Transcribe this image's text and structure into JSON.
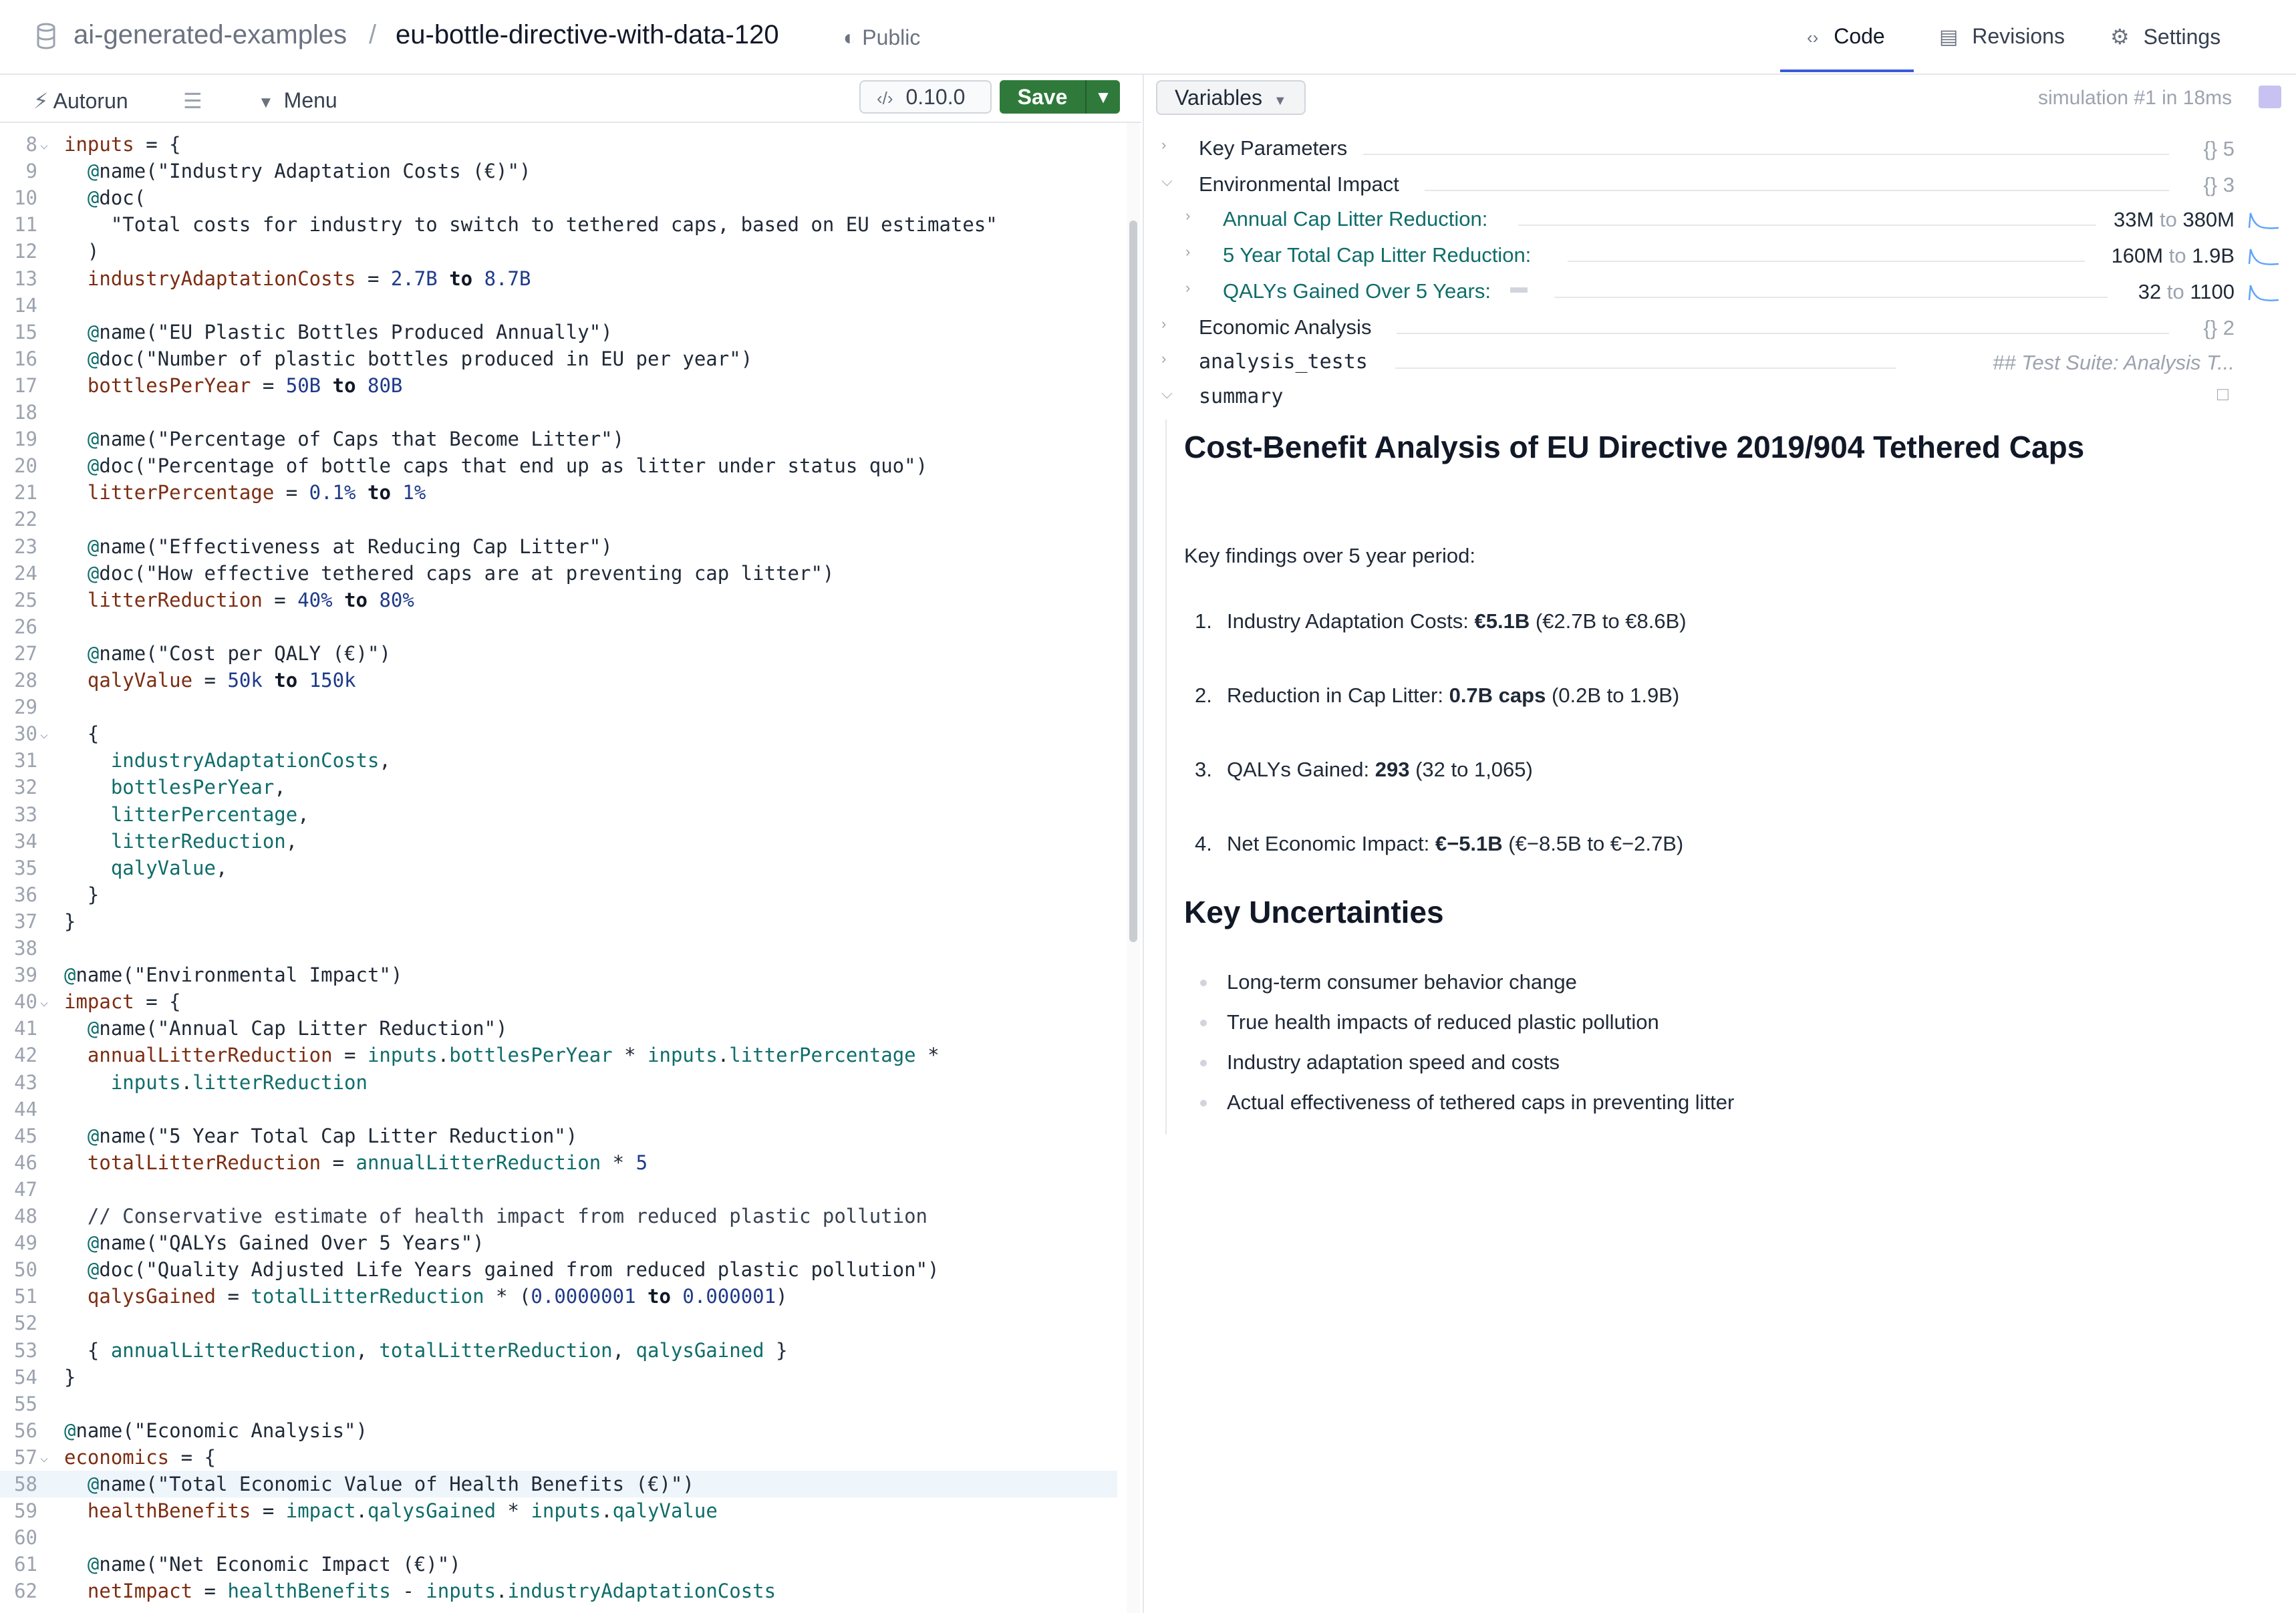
{
  "header": {
    "owner": "ai-generated-examples",
    "separator": "/",
    "model": "eu-bottle-directive-with-data-120",
    "visibility": "Public",
    "tabs": [
      {
        "label": "Code",
        "icon": "code-icon",
        "active": true
      },
      {
        "label": "Revisions",
        "icon": "revisions-icon",
        "active": false
      },
      {
        "label": "Settings",
        "icon": "gear-icon",
        "active": false
      }
    ]
  },
  "toolbar": {
    "autorun": "Autorun",
    "menu": "Menu",
    "version": "0.10.0",
    "save": "Save"
  },
  "editor": {
    "highlighted_line": 58,
    "lines": [
      {
        "n": "8",
        "fold": true,
        "code": "inputs = {"
      },
      {
        "n": "9",
        "code": "  @name(\"Industry Adaptation Costs (€)\")"
      },
      {
        "n": "10",
        "code": "  @doc("
      },
      {
        "n": "11",
        "code": "    \"Total costs for industry to switch to tethered caps, based on EU estimates\""
      },
      {
        "n": "12",
        "code": "  )"
      },
      {
        "n": "13",
        "code": "  industryAdaptationCosts = 2.7B to 8.7B"
      },
      {
        "n": "14",
        "code": ""
      },
      {
        "n": "15",
        "code": "  @name(\"EU Plastic Bottles Produced Annually\")"
      },
      {
        "n": "16",
        "code": "  @doc(\"Number of plastic bottles produced in EU per year\")"
      },
      {
        "n": "17",
        "code": "  bottlesPerYear = 50B to 80B"
      },
      {
        "n": "18",
        "code": ""
      },
      {
        "n": "19",
        "code": "  @name(\"Percentage of Caps that Become Litter\")"
      },
      {
        "n": "20",
        "code": "  @doc(\"Percentage of bottle caps that end up as litter under status quo\")"
      },
      {
        "n": "21",
        "code": "  litterPercentage = 0.1% to 1%"
      },
      {
        "n": "22",
        "code": ""
      },
      {
        "n": "23",
        "code": "  @name(\"Effectiveness at Reducing Cap Litter\")"
      },
      {
        "n": "24",
        "code": "  @doc(\"How effective tethered caps are at preventing cap litter\")"
      },
      {
        "n": "25",
        "code": "  litterReduction = 40% to 80%"
      },
      {
        "n": "26",
        "code": ""
      },
      {
        "n": "27",
        "code": "  @name(\"Cost per QALY (€)\")"
      },
      {
        "n": "28",
        "code": "  qalyValue = 50k to 150k"
      },
      {
        "n": "29",
        "code": ""
      },
      {
        "n": "30",
        "fold": true,
        "code": "  {"
      },
      {
        "n": "31",
        "code": "    industryAdaptationCosts,"
      },
      {
        "n": "32",
        "code": "    bottlesPerYear,"
      },
      {
        "n": "33",
        "code": "    litterPercentage,"
      },
      {
        "n": "34",
        "code": "    litterReduction,"
      },
      {
        "n": "35",
        "code": "    qalyValue,"
      },
      {
        "n": "36",
        "code": "  }"
      },
      {
        "n": "37",
        "code": "}"
      },
      {
        "n": "38",
        "code": ""
      },
      {
        "n": "39",
        "code": "@name(\"Environmental Impact\")"
      },
      {
        "n": "40",
        "fold": true,
        "code": "impact = {"
      },
      {
        "n": "41",
        "code": "  @name(\"Annual Cap Litter Reduction\")"
      },
      {
        "n": "42",
        "code": "  annualLitterReduction = inputs.bottlesPerYear * inputs.litterPercentage *"
      },
      {
        "n": "43",
        "code": "    inputs.litterReduction"
      },
      {
        "n": "44",
        "code": ""
      },
      {
        "n": "45",
        "code": "  @name(\"5 Year Total Cap Litter Reduction\")"
      },
      {
        "n": "46",
        "code": "  totalLitterReduction = annualLitterReduction * 5"
      },
      {
        "n": "47",
        "code": ""
      },
      {
        "n": "48",
        "code": "  // Conservative estimate of health impact from reduced plastic pollution"
      },
      {
        "n": "49",
        "code": "  @name(\"QALYs Gained Over 5 Years\")"
      },
      {
        "n": "50",
        "code": "  @doc(\"Quality Adjusted Life Years gained from reduced plastic pollution\")"
      },
      {
        "n": "51",
        "code": "  qalysGained = totalLitterReduction * (0.0000001 to 0.000001)"
      },
      {
        "n": "52",
        "code": ""
      },
      {
        "n": "53",
        "code": "  { annualLitterReduction, totalLitterReduction, qalysGained }"
      },
      {
        "n": "54",
        "code": "}"
      },
      {
        "n": "55",
        "code": ""
      },
      {
        "n": "56",
        "code": "@name(\"Economic Analysis\")"
      },
      {
        "n": "57",
        "fold": true,
        "code": "economics = {"
      },
      {
        "n": "58",
        "code": "  @name(\"Total Economic Value of Health Benefits (€)\")"
      },
      {
        "n": "59",
        "code": "  healthBenefits = impact.qalysGained * inputs.qalyValue"
      },
      {
        "n": "60",
        "code": ""
      },
      {
        "n": "61",
        "code": "  @name(\"Net Economic Impact (€)\")"
      },
      {
        "n": "62",
        "code": "  netImpact = healthBenefits - inputs.industryAdaptationCosts"
      }
    ]
  },
  "variables": {
    "button": "Variables",
    "simulation": "simulation #1 in 18ms",
    "tree": [
      {
        "label": "Key Parameters",
        "meta": "{} 5"
      },
      {
        "label": "Environmental Impact",
        "meta": "{} 3",
        "expanded": true
      },
      {
        "label": "Annual Cap Litter Reduction",
        "low": "33M",
        "high": "380M"
      },
      {
        "label": "5 Year Total Cap Litter Reduction",
        "low": "160M",
        "high": "1.9B"
      },
      {
        "label": "QALYs Gained Over 5 Years",
        "low": "32",
        "high": "1100"
      },
      {
        "label": "Economic Analysis",
        "meta": "{} 2"
      },
      {
        "label": "analysis_tests",
        "meta": "## Test Suite: Analysis T..."
      },
      {
        "label": "summary",
        "expanded": true
      }
    ],
    "to": "to"
  },
  "summary": {
    "title": "Cost-Benefit Analysis of EU Directive 2019/904 Tethered Caps",
    "intro": "Key findings over 5 year period:",
    "findings": [
      {
        "num": "1.",
        "label": "Industry Adaptation Costs: ",
        "bold": "€5.1B",
        "rest": " (€2.7B to €8.6B)"
      },
      {
        "num": "2.",
        "label": "Reduction in Cap Litter: ",
        "bold": "0.7B caps",
        "rest": " (0.2B to 1.9B)"
      },
      {
        "num": "3.",
        "label": "QALYs Gained: ",
        "bold": "293",
        "rest": " (32 to 1,065)"
      },
      {
        "num": "4.",
        "label": "Net Economic Impact: ",
        "bold": "€−5.1B",
        "rest": " (€−8.5B to €−2.7B)"
      }
    ],
    "uncertainties_title": "Key Uncertainties",
    "uncertainties": [
      "Long-term consumer behavior change",
      "True health impacts of reduced plastic pollution",
      "Industry adaptation speed and costs",
      "Actual effectiveness of tethered caps in preventing litter"
    ]
  }
}
